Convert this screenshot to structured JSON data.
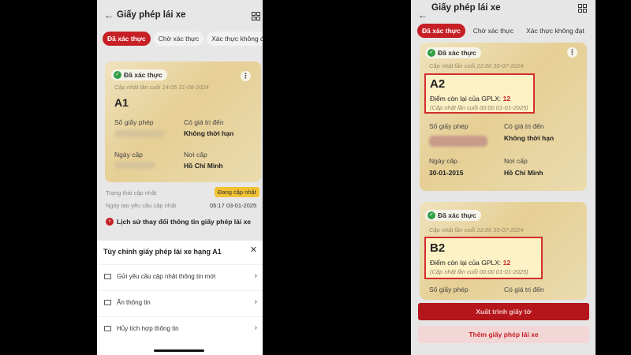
{
  "left": {
    "title": "Giấy phép lái xe",
    "tabs": [
      "Đã xác thực",
      "Chờ xác thực",
      "Xác thực không đạt"
    ],
    "card": {
      "badge": "Đã xác thực",
      "updated": "Cập nhật lần cuối 14:05 31-08-2024",
      "class_code": "A1",
      "license_no_label": "Số giấy phép",
      "valid_until_label": "Có giá trị đến",
      "valid_until_value": "Không thời hạn",
      "issue_date_label": "Ngày cấp",
      "issue_place_label": "Nơi cấp",
      "issue_place_value": "Hồ Chí Minh"
    },
    "status": {
      "update_status_label": "Trạng thái cập nhật",
      "update_status_value": "Đang cập nhật",
      "request_date_label": "Ngày tạo yêu cầu cập nhật",
      "request_date_value": "05:17 03-01-2025"
    },
    "history_link": "Lịch sử thay đổi thông tin giấy phép lái xe",
    "sheet": {
      "title": "Tùy chỉnh giấy phép lái xe hạng A1",
      "items": [
        "Gửi yêu cầu cập nhật thông tin mới",
        "Ẩn thông tin",
        "Hủy tích hợp thông tin"
      ]
    }
  },
  "right": {
    "title": "Giấy phép lái xe",
    "tabs": [
      "Đã xác thực",
      "Chờ xác thực",
      "Xác thực không đạt"
    ],
    "card_a2": {
      "badge": "Đã xác thực",
      "updated": "Cập nhật lần cuối 22:06 30-07-2024",
      "class_code": "A2",
      "points_label": "Điểm còn lại của GPLX:",
      "points_value": "12",
      "points_updated": "(Cập nhật lần cuối 00:00 01-01-2025)",
      "license_no_label": "Số giấy phép",
      "valid_until_label": "Có giá trị đến",
      "valid_until_value": "Không thời hạn",
      "issue_date_label": "Ngày cấp",
      "issue_date_value": "30-01-2015",
      "issue_place_label": "Nơi cấp",
      "issue_place_value": "Hồ Chí Minh"
    },
    "card_b2": {
      "badge": "Đã xác thực",
      "updated": "Cập nhật lần cuối 22:06 30-07-2024",
      "class_code": "B2",
      "points_label": "Điểm còn lại của GPLX:",
      "points_value": "12",
      "points_updated": "(Cập nhật lần cuối 00:00 01-01-2025)",
      "license_no_label": "Số giấy phép",
      "valid_until_label": "Có giá trị đến"
    },
    "buttons": {
      "present": "Xuất trình giấy tờ",
      "add": "Thêm giấy phép lái xe"
    }
  },
  "colors": {
    "accent": "#c62026",
    "verified": "#2f9e44",
    "card_gold": "#e6cf95",
    "status_yellow": "#f1c232"
  }
}
